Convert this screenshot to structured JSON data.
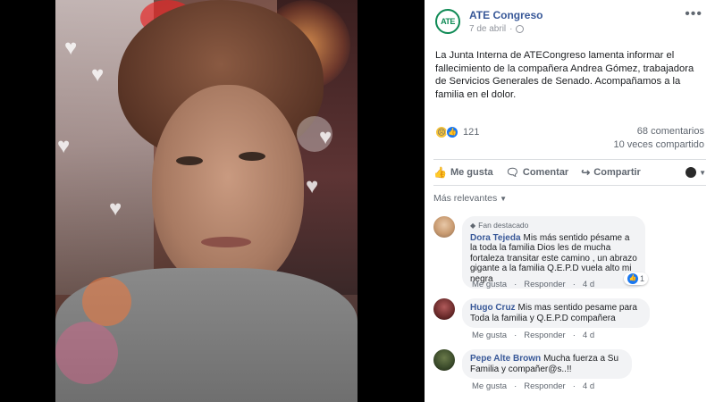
{
  "post": {
    "page_name": "ATE Congreso",
    "avatar_text": "ATE",
    "date": "7 de abril",
    "text": "La Junta Interna de ATECongreso lamenta informar el fallecimiento de la compañera Andrea Gómez, trabajadora de Servicios Generales de Senado. Acompañamos a la familia en el dolor.",
    "reaction_count": "121",
    "comments_count": "68 comentarios",
    "shares_count": "10 veces compartido"
  },
  "actions": {
    "like": "Me gusta",
    "comment": "Comentar",
    "share": "Compartir"
  },
  "sort": {
    "label": "Más relevantes"
  },
  "comments": [
    {
      "badge": "Fan destacado",
      "author": "Dora Tejeda",
      "text": "Mis más sentido pésame a la toda la familia Dios les de mucha fortaleza transitar este camino , un abrazo gigante a la familia Q.E.P.D vuela alto mi negra",
      "like_label": "Me gusta",
      "reply_label": "Responder",
      "time": "4 d",
      "reaction_count": "1"
    },
    {
      "author": "Hugo Cruz",
      "text": "Mis mas sentido pesame para Toda la familia y Q.E.P.D compañera",
      "like_label": "Me gusta",
      "reply_label": "Responder",
      "time": "4 d"
    },
    {
      "author": "Pepe Alte Brown",
      "text": "Mucha fuerza a Su Familia y compañer@s..!!",
      "like_label": "Me gusta",
      "reply_label": "Responder",
      "time": "4 d"
    }
  ],
  "colors": {
    "link_blue": "#385898",
    "ate_green": "#0f8a55",
    "like_blue": "#1877f2"
  }
}
